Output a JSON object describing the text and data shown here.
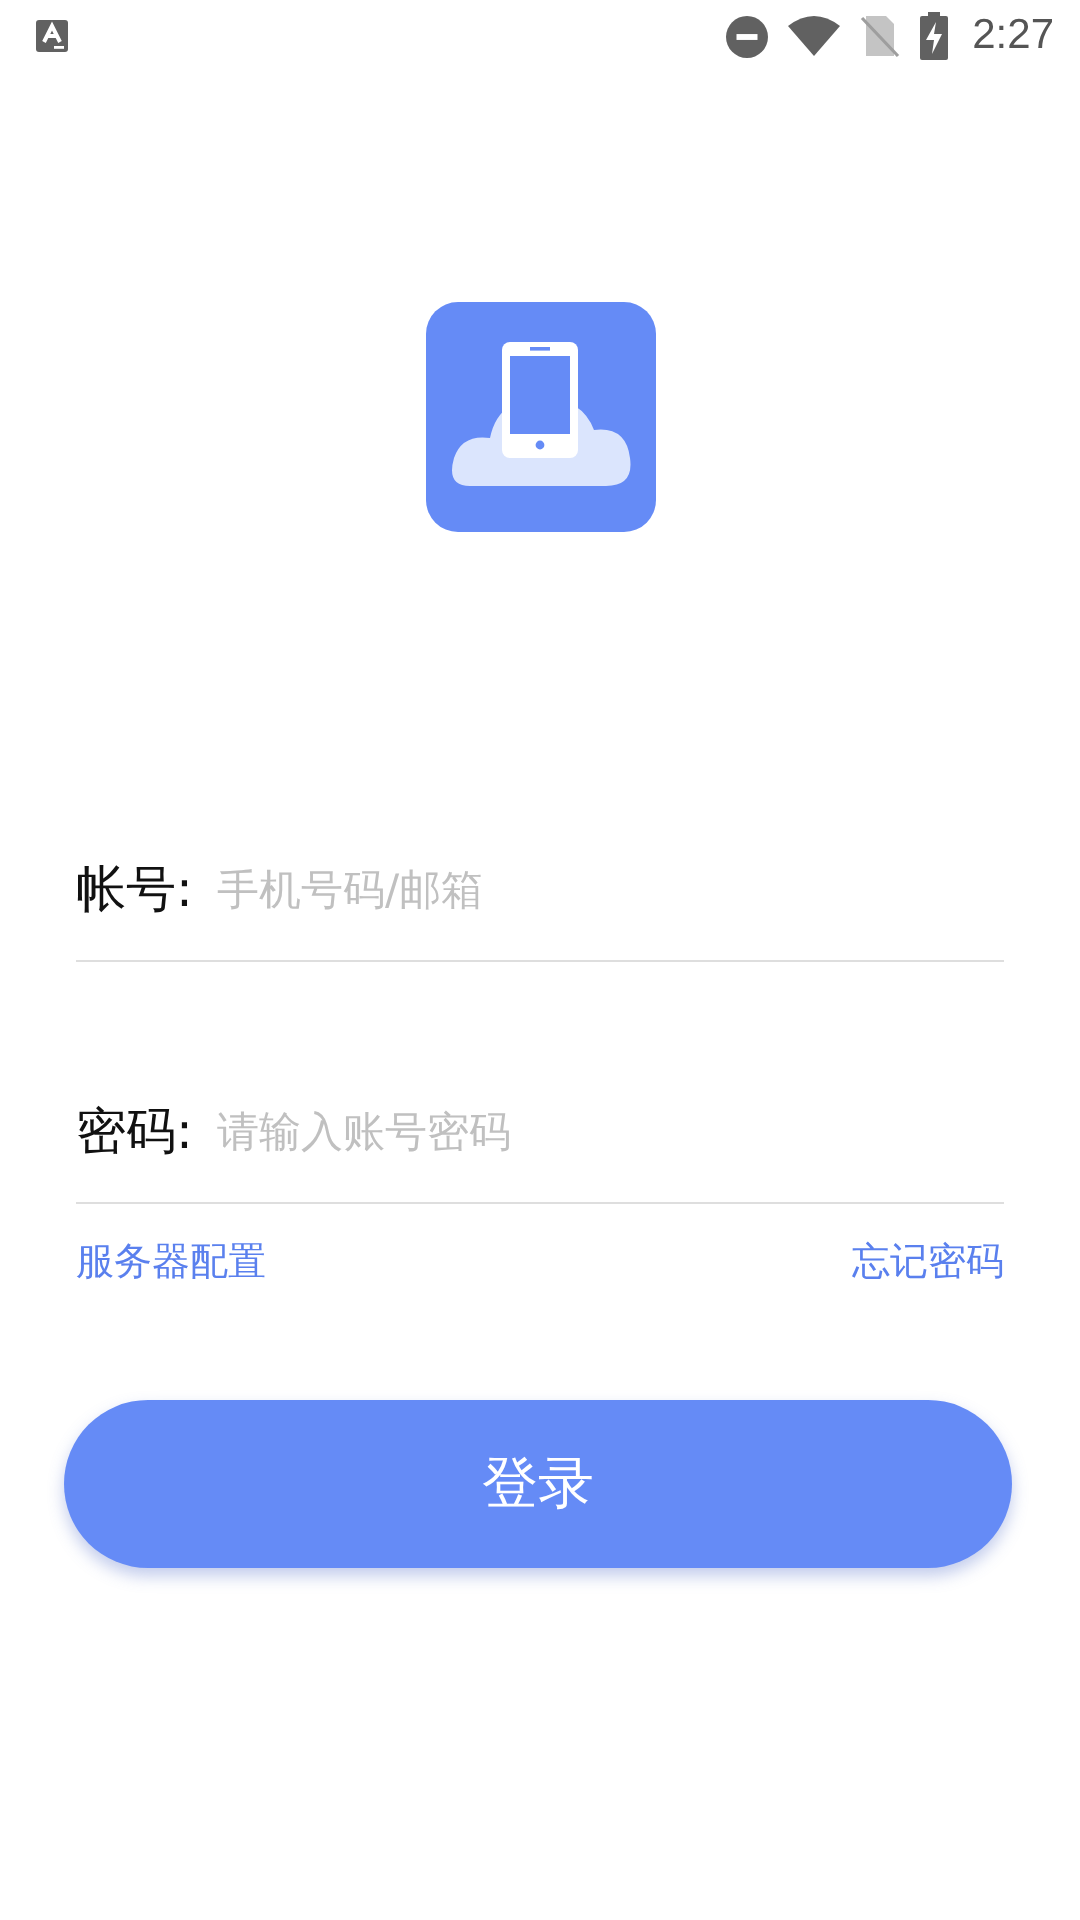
{
  "status_bar": {
    "time": "2:27"
  },
  "form": {
    "fields": [
      {
        "label": "帐号:",
        "placeholder": "手机号码/邮箱"
      },
      {
        "label": "密码:",
        "placeholder": "请输入账号密码"
      }
    ],
    "links": [
      "服务器配置",
      "忘记密码"
    ],
    "submit": "登录"
  }
}
